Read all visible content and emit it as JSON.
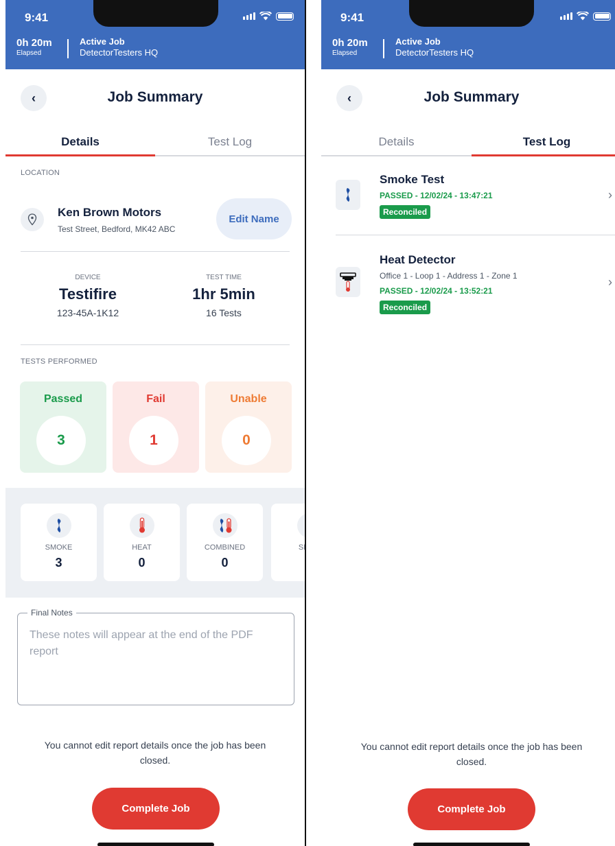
{
  "status_bar": {
    "time": "9:41"
  },
  "header": {
    "elapsed_value": "0h 20m",
    "elapsed_label": "Elapsed",
    "job_status": "Active Job",
    "company": "DetectorTesters HQ"
  },
  "page": {
    "title": "Job Summary",
    "back_icon": "chevron-left-icon"
  },
  "tabs": [
    {
      "label": "Details"
    },
    {
      "label": "Test Log"
    }
  ],
  "details": {
    "location_label": "LOCATION",
    "location_name": "Ken Brown Motors",
    "location_address": "Test Street, Bedford, MK42 ABC",
    "edit_name_label": "Edit Name",
    "device_label": "DEVICE",
    "device_name": "Testifire",
    "device_serial": "123-45A-1K12",
    "test_time_label": "TEST TIME",
    "test_time_value": "1hr 5min",
    "test_count": "16 Tests",
    "tests_performed_label": "TESTS PERFORMED",
    "results": [
      {
        "label": "Passed",
        "count": "3",
        "color": "#1a9b4b",
        "bg": "#e5f4ea"
      },
      {
        "label": "Fail",
        "count": "1",
        "color": "#e03a32",
        "bg": "#fde8e7"
      },
      {
        "label": "Unable",
        "count": "0",
        "color": "#ee7b34",
        "bg": "#fdf0e9"
      }
    ],
    "detector_types": [
      {
        "icon": "smoke-icon",
        "label": "SMOKE",
        "count": "3"
      },
      {
        "icon": "thermometer-icon",
        "label": "HEAT",
        "count": "0"
      },
      {
        "icon": "combined-icon",
        "label": "COMBINED",
        "count": "0"
      },
      {
        "icon": "sequential-icon",
        "label": "SEQU",
        "count": ""
      }
    ],
    "notes_label": "Final Notes",
    "notes_placeholder": "These notes will appear at the end of the PDF report"
  },
  "test_log": [
    {
      "icon": "smoke-icon",
      "title": "Smoke Test",
      "location": "",
      "result": "PASSED - 12/02/24 - 13:47:21",
      "badge": "Reconciled"
    },
    {
      "icon": "heat-detector-icon",
      "title": "Heat Detector",
      "location": "Office 1 - Loop 1 - Address 1 - Zone 1",
      "result": "PASSED - 12/02/24 - 13:52:21",
      "badge": "Reconciled"
    }
  ],
  "footer": {
    "warning": "You cannot edit report details once the job has been closed.",
    "complete_label": "Complete Job"
  },
  "colors": {
    "header_blue": "#3d6cbd",
    "accent_red": "#e03a32",
    "pass_green": "#1a9b4b"
  }
}
